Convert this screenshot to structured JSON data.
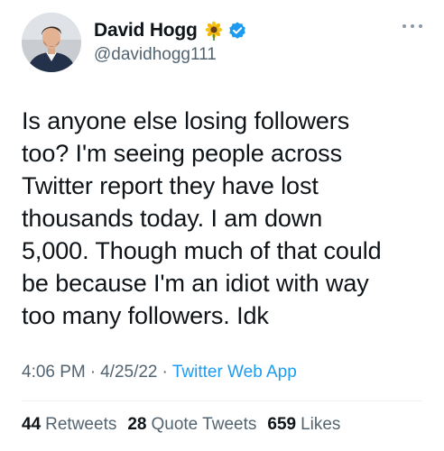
{
  "tweet": {
    "author": {
      "display_name": "David Hogg",
      "handle": "@davidhogg111",
      "emoji_icon": "sunflower-icon",
      "verified_icon": "verified-badge-icon"
    },
    "text": "Is anyone else losing followers\ntoo? I'm seeing people across\nTwitter report they have lost\nthousands today. I am down\n5,000. Though much of that could\nbe because I'm an idiot with way\ntoo many followers. Idk",
    "time": "4:06 PM",
    "separator": "·",
    "date": "4/25/22",
    "source": "Twitter Web App",
    "stats": {
      "retweets": {
        "count": "44",
        "label": "Retweets"
      },
      "quote_tweets": {
        "count": "28",
        "label": "Quote Tweets"
      },
      "likes": {
        "count": "659",
        "label": "Likes"
      }
    }
  },
  "colors": {
    "text": "#0f1419",
    "secondary": "#536471",
    "link": "#1d9bf0",
    "verified": "#1d9bf0",
    "divider": "#eff3f4"
  }
}
